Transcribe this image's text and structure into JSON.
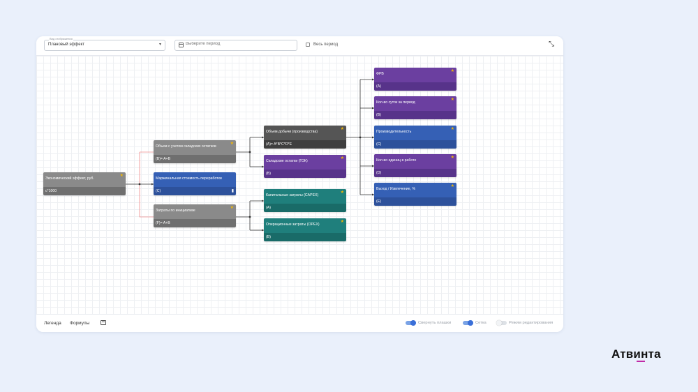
{
  "toolbar": {
    "view_mode_label": "Вид отображения",
    "view_mode_value": "Плановый эффект",
    "period_placeholder": "Выберите период",
    "all_period_label": "Весь период"
  },
  "nodes": {
    "economic_effect": {
      "title": "Экономический эффект, руб.",
      "formula": "с*1000",
      "top": "#8a8a8a",
      "bottom": "#6f6f6f"
    },
    "volume_stock": {
      "title": "Объем с учетом складских остатков",
      "formula": "(B)= A+B",
      "top": "#8a8a8a",
      "bottom": "#6f6f6f"
    },
    "marginal_cost": {
      "title": "Маржинальная стоимость переработки",
      "formula": "(C)",
      "top": "#3560b5",
      "bottom": "#2d519b"
    },
    "init_costs": {
      "title": "Затраты по инициативе",
      "formula": "(F)= A+B",
      "top": "#8a8a8a",
      "bottom": "#6f6f6f"
    },
    "mining_volume": {
      "title": "Объем добычи (производства)",
      "formula": "(A)= A*B*C*D*E",
      "top": "#555555",
      "bottom": "#3f3f3f"
    },
    "stock_remains": {
      "title": "Складские остатки (ГОК)",
      "formula": "(B)",
      "top": "#6b3fa0",
      "bottom": "#57338a"
    },
    "capex": {
      "title": "Капитальные затраты (CAPEX)",
      "formula": "(A)",
      "top": "#1f7f7c",
      "bottom": "#196b68"
    },
    "opex": {
      "title": "Операционные затраты (OPEX)",
      "formula": "(B)",
      "top": "#1f7f7c",
      "bottom": "#196b68"
    },
    "fvr": {
      "title": "ФРВ",
      "formula": "(A)",
      "top": "#6b3fa0",
      "bottom": "#57338a"
    },
    "days": {
      "title": "Кол-во суток за период",
      "formula": "(B)",
      "top": "#6b3fa0",
      "bottom": "#57338a"
    },
    "productivity": {
      "title": "Производительность",
      "formula": "(C)",
      "top": "#3560b5",
      "bottom": "#2d519b"
    },
    "units": {
      "title": "Кол-во единиц в работе",
      "formula": "(D)",
      "top": "#6b3fa0",
      "bottom": "#57338a"
    },
    "yield": {
      "title": "Выход / Извлечение, %",
      "formula": "(E)",
      "top": "#3560b5",
      "bottom": "#2d519b"
    }
  },
  "footer": {
    "legend_tab": "Легенда",
    "formulas_tab": "Формулы",
    "collapse_label": "Свернуть плашки",
    "grid_label": "Сетка",
    "edit_mode_label": "Режим редактирования"
  },
  "brand": {
    "logo_text": "Атвинта",
    "accent": "#c02aa7"
  },
  "colors": {
    "background": "#eaf0fb",
    "switch_on": "#3a6fd8",
    "connector": "#333333",
    "connector_highlight": "#f08c8c",
    "star": "#f2b705"
  }
}
